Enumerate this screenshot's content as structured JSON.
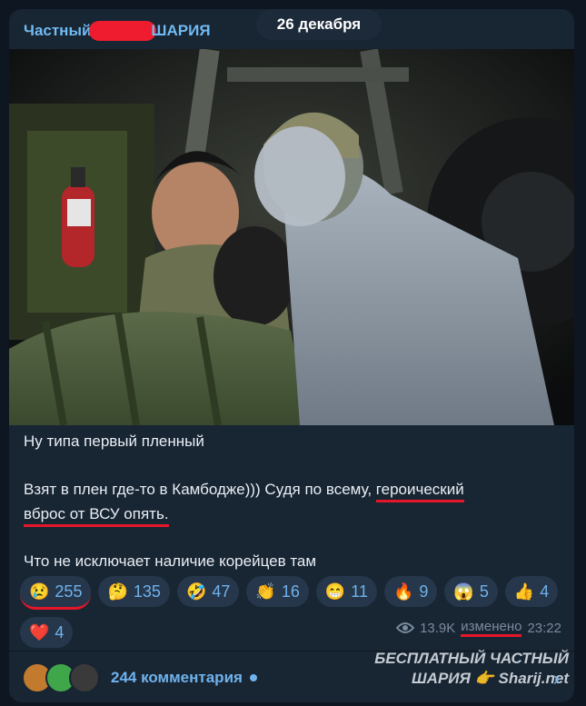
{
  "date_pill": "26 декабря",
  "channel": {
    "name_left": "Частный",
    "name_right": "ШАРИЯ"
  },
  "post": {
    "line1": "Ну типа первый пленный",
    "line2_a": "Взят в плен где-то в Камбодже))) Судя по всему, ",
    "line2_b": "героический",
    "line3": "вброс от ВСУ опять.",
    "line4": "Что не исключает наличие корейцев там"
  },
  "reactions": [
    {
      "emoji": "😢",
      "count": "255"
    },
    {
      "emoji": "🤔",
      "count": "135"
    },
    {
      "emoji": "🤣",
      "count": "47"
    },
    {
      "emoji": "👏",
      "count": "16"
    },
    {
      "emoji": "😁",
      "count": "11"
    },
    {
      "emoji": "🔥",
      "count": "9"
    },
    {
      "emoji": "😱",
      "count": "5"
    },
    {
      "emoji": "👍",
      "count": "4"
    },
    {
      "emoji": "❤️",
      "count": "4"
    }
  ],
  "meta": {
    "views": "13.9K",
    "edited": "изменено",
    "time": "23:22"
  },
  "comments": {
    "label": "244 комментария"
  },
  "watermark": {
    "line1": "БЕСПЛАТНЫЙ ЧАСТНЫЙ",
    "line2": "ШАРИЯ 👉 Sharij.net"
  }
}
